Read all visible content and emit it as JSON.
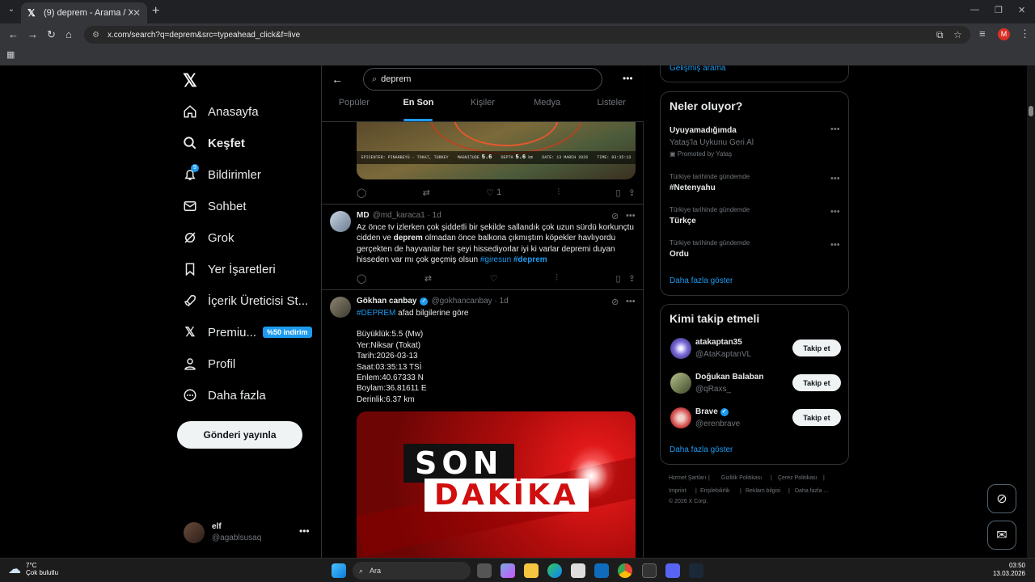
{
  "browser": {
    "tab_title": "(9) deprem - Arama / X",
    "url": "x.com/search?q=deprem&src=typeahead_click&f=live",
    "profile_initial": "M"
  },
  "nav": {
    "items": [
      {
        "label": "Anasayfa",
        "icon": "home-icon"
      },
      {
        "label": "Keşfet",
        "icon": "search-icon"
      },
      {
        "label": "Bildirimler",
        "icon": "bell-icon",
        "badge": "9"
      },
      {
        "label": "Sohbet",
        "icon": "mail-icon"
      },
      {
        "label": "Grok",
        "icon": "grok-icon"
      },
      {
        "label": "Yer İşaretleri",
        "icon": "bookmark-icon"
      },
      {
        "label": "İçerik Üreticisi St...",
        "icon": "rocket-icon"
      },
      {
        "label": "Premiu...",
        "icon": "x-logo-icon",
        "promo": "%50 indirim"
      },
      {
        "label": "Profil",
        "icon": "person-icon"
      },
      {
        "label": "Daha fazla",
        "icon": "more-circle-icon"
      }
    ],
    "post_button": "Gönderi yayınla",
    "account": {
      "name": "elf",
      "handle": "@agablsusaq"
    }
  },
  "search": {
    "query": "deprem",
    "tabs": [
      "Popüler",
      "En Son",
      "Kişiler",
      "Medya",
      "Listeler"
    ],
    "active_tab": "En Son"
  },
  "feed": {
    "map_post": {
      "epicentre": "EPICENTER: PINARBEYÜ - TOKAT, TURKEY",
      "magnitude_label": "MAGNITUDE",
      "magnitude": "5.6",
      "depth_label": "DEPTH",
      "depth": "5.6",
      "depth_unit": "km",
      "date": "DATE: 13 MARCH 2026",
      "time": "TIME: 03:35:13",
      "likes": "1"
    },
    "post1": {
      "name": "MD",
      "handle": "@md_karaca1 · 1d",
      "text_a": "Az önce tv izlerken çok şiddetli bir şekilde sallandık çok uzun sürdü korkunçtu cidden ve ",
      "bold": "deprem",
      "text_b": " olmadan önce balkona çıkmıştım köpekler havlıyordu gerçekten de hayvanlar her şeyi hissediyorlar iyi ki varlar depremi duyan hisseden var mı çok geçmiş olsun ",
      "tag1": "#giresun",
      "tag2": "#deprem"
    },
    "post2": {
      "name": "Gökhan canbay",
      "handle": "@gokhancanbay · 1d",
      "tag": "#DEPREM",
      "intro": " afad bilgilerine göre",
      "lines": [
        "Büyüklük:5.5 (Mw)",
        "Yer:Niksar (Tokat)",
        "Tarih:2026-03-13",
        "Saat:03:35:13 TSİ",
        "Enlem:40.67333 N",
        "Boylam:36.81611 E",
        "Derinlik:6.37 km"
      ],
      "image_top": "SON",
      "image_bottom": "DAKİKA"
    }
  },
  "right": {
    "advanced_search": "Gelişmiş arama",
    "trends_title": "Neler oluyor?",
    "promoted": {
      "title": "Uyuyamadığımda",
      "sub": "Yataş'la Uykunu Geri Al",
      "tag": "Promoted by Yataş"
    },
    "trends": [
      {
        "context": "Türkiye tarihinde gündemde",
        "name": "#Netenyahu"
      },
      {
        "context": "Türkiye tarihinde gündemde",
        "name": "Türkçe"
      },
      {
        "context": "Türkiye tarihinde gündemde",
        "name": "Ordu"
      }
    ],
    "show_more": "Daha fazla göster",
    "follow_title": "Kimi takip etmeli",
    "follow": [
      {
        "name": "atakaptan35",
        "handle": "@AtaKaptanVL",
        "button": "Takip et"
      },
      {
        "name": "Doğukan Balaban",
        "handle": "@qRaxs_",
        "button": "Takip et"
      },
      {
        "name": "Brave",
        "handle": "@erenbrave",
        "button": "Takip et"
      }
    ],
    "footer": [
      "Hizmet Şartları",
      "Gizlilik Politikası",
      "Çerez Politikası",
      "Imprint",
      "Erişilebilirlik",
      "Reklam bilgisi",
      "Daha fazla ...",
      "© 2026 X Corp."
    ]
  },
  "taskbar": {
    "temp": "7°C",
    "weather": "Çok bulutlu",
    "search_placeholder": "Ara",
    "time": "03:50",
    "date": "13.03.2026"
  }
}
